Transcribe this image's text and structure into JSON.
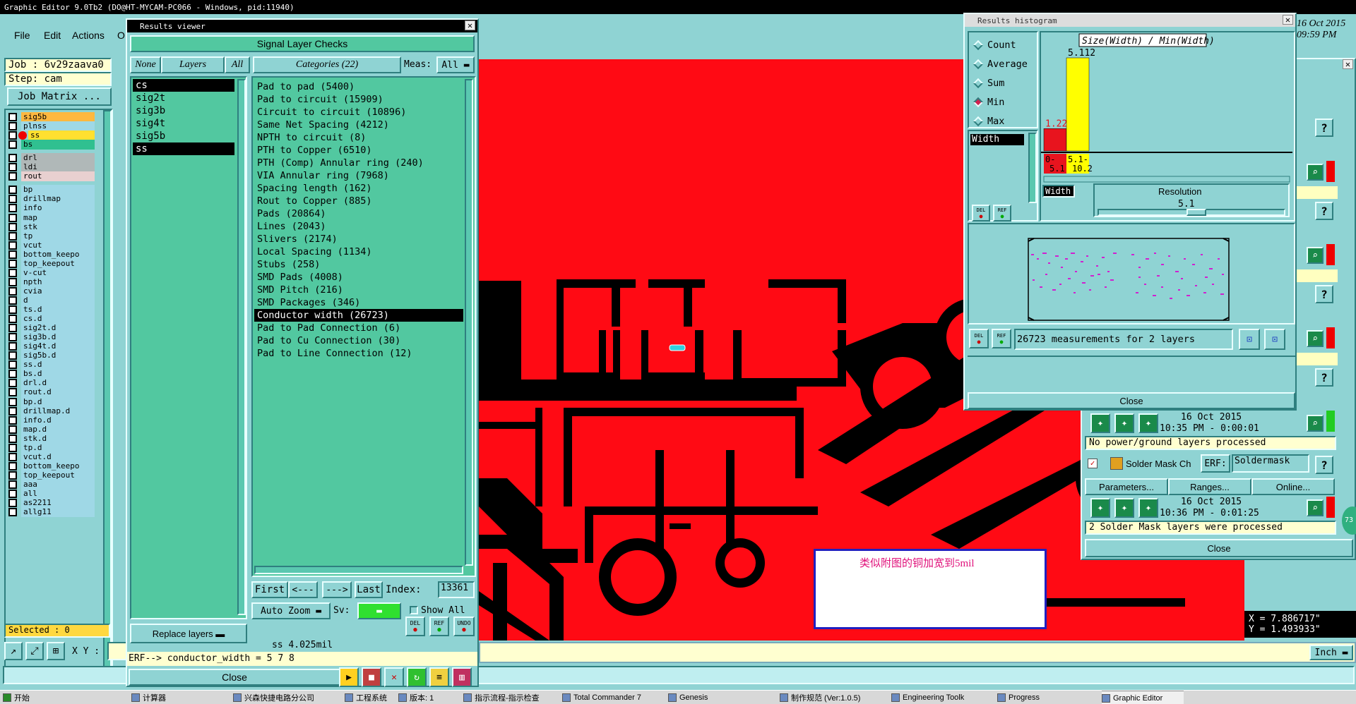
{
  "main_window": {
    "title": "Graphic Editor 9.0Tb2 (DO@HT-MYCAM-PC066 - Windows, pid:11940)",
    "menu": [
      "File",
      "Edit",
      "Actions",
      "O"
    ],
    "date_line1": "16 Oct 2015",
    "date_line2": "09:59 PM"
  },
  "job_panel": {
    "job_label": "Job : 6v29zaava0",
    "step_label": "Step: cam",
    "job_matrix_button": "Job Matrix ...",
    "selected_label": "Selected : 0",
    "xy_label": "X Y :",
    "layers": [
      {
        "name": "sig5b",
        "color": "#ffb840"
      },
      {
        "name": "plnss",
        "color": "#9fd8e6"
      },
      {
        "name": "ss",
        "color": "#ffe030",
        "marker": "red"
      },
      {
        "name": "bs",
        "color": "#30c090"
      },
      {
        "name": "drl",
        "color": "#b0b8b8"
      },
      {
        "name": "ldi",
        "color": "#b0b8b8"
      },
      {
        "name": "rout",
        "color": "#e8d0d0"
      },
      {
        "name": "bp",
        "color": "#9fd8e6"
      },
      {
        "name": "drillmap",
        "color": "#9fd8e6"
      },
      {
        "name": "info",
        "color": "#9fd8e6"
      },
      {
        "name": "map",
        "color": "#9fd8e6"
      },
      {
        "name": "stk",
        "color": "#9fd8e6"
      },
      {
        "name": "tp",
        "color": "#9fd8e6"
      },
      {
        "name": "vcut",
        "color": "#9fd8e6"
      },
      {
        "name": "bottom_keepo",
        "color": "#9fd8e6"
      },
      {
        "name": "top_keepout",
        "color": "#9fd8e6"
      },
      {
        "name": "v-cut",
        "color": "#9fd8e6"
      },
      {
        "name": "npth",
        "color": "#9fd8e6"
      },
      {
        "name": "cvia",
        "color": "#9fd8e6"
      },
      {
        "name": "d",
        "color": "#9fd8e6"
      },
      {
        "name": "ts.d",
        "color": "#9fd8e6"
      },
      {
        "name": "cs.d",
        "color": "#9fd8e6"
      },
      {
        "name": "sig2t.d",
        "color": "#9fd8e6"
      },
      {
        "name": "sig3b.d",
        "color": "#9fd8e6"
      },
      {
        "name": "sig4t.d",
        "color": "#9fd8e6"
      },
      {
        "name": "sig5b.d",
        "color": "#9fd8e6"
      },
      {
        "name": "ss.d",
        "color": "#9fd8e6"
      },
      {
        "name": "bs.d",
        "color": "#9fd8e6"
      },
      {
        "name": "drl.d",
        "color": "#9fd8e6"
      },
      {
        "name": "rout.d",
        "color": "#9fd8e6"
      },
      {
        "name": "bp.d",
        "color": "#9fd8e6"
      },
      {
        "name": "drillmap.d",
        "color": "#9fd8e6"
      },
      {
        "name": "info.d",
        "color": "#9fd8e6"
      },
      {
        "name": "map.d",
        "color": "#9fd8e6"
      },
      {
        "name": "stk.d",
        "color": "#9fd8e6"
      },
      {
        "name": "tp.d",
        "color": "#9fd8e6"
      },
      {
        "name": "vcut.d",
        "color": "#9fd8e6"
      },
      {
        "name": "bottom_keepo",
        "color": "#9fd8e6"
      },
      {
        "name": "top_keepout",
        "color": "#9fd8e6"
      },
      {
        "name": "aaa",
        "color": "#9fd8e6"
      },
      {
        "name": "all",
        "color": "#9fd8e6"
      },
      {
        "name": "as2211",
        "color": "#9fd8e6"
      },
      {
        "name": "allg11",
        "color": "#9fd8e6"
      }
    ]
  },
  "results_viewer": {
    "title": "Results viewer",
    "header": "Signal Layer Checks",
    "none_btn": "None",
    "layers_label": "Layers",
    "all_btn": "All",
    "categories_label": "Categories (22)",
    "meas_label": "Meas:",
    "meas_value": "All",
    "layers": [
      "cs",
      "sig2t",
      "sig3b",
      "sig4t",
      "sig5b",
      "ss"
    ],
    "categories": [
      "Pad to pad (5400)",
      "Pad to circuit (15909)",
      "Circuit to circuit (10896)",
      "Same Net Spacing (4212)",
      "NPTH to circuit (8)",
      "PTH to Copper (6510)",
      "PTH (Comp) Annular ring (240)",
      "VIA Annular ring (7968)",
      "Spacing length (162)",
      "Rout to Copper (885)",
      "Pads (20864)",
      "Lines (2043)",
      "Slivers (2174)",
      "Local Spacing (1134)",
      "Stubs (258)",
      "SMD Pads (4008)",
      "SMD Pitch (216)",
      "SMD Packages (346)",
      "Conductor width (26723)",
      "Pad to Pad Connection (6)",
      "Pad to Cu Connection (30)",
      "Pad to Line Connection (12)"
    ],
    "selected_category": "Conductor width (26723)",
    "first_btn": "First",
    "prev_btn": "<---",
    "next_btn": "--->",
    "last_btn": "Last",
    "index_label": "Index:",
    "index_value": "13361",
    "auto_zoom": "Auto Zoom",
    "sv_label": "Sv:",
    "show_all": "Show All",
    "replace_layers": "Replace layers",
    "del": "DEL",
    "ref": "REF",
    "undo": "UNDO",
    "status": "ss 4.025mil",
    "erf_line": "ERF--> conductor_width = 5 7 8",
    "close": "Close"
  },
  "histogram": {
    "title": "Results histogram",
    "options": [
      "Count",
      "Average",
      "Sum",
      "Min",
      "Max"
    ],
    "selected_option": "Min",
    "list_item": "Width",
    "chart_title": "Size(Width) / Min(Width)",
    "width_label": "Width",
    "resolution_label": "Resolution",
    "resolution_value": "5.1",
    "measurements": "26723 measurements for 2 layers",
    "close": "Close",
    "del": "DEL",
    "ref": "REF"
  },
  "chart_data": {
    "type": "bar",
    "title": "Size(Width) / Min(Width)",
    "categories": [
      "0-5.1",
      "5.1-10.2"
    ],
    "values": [
      1.228,
      5.112
    ],
    "colors": [
      "#e8141e",
      "#ffff00"
    ],
    "category_labels_line1": [
      "0-",
      "5.1-"
    ],
    "category_labels_line2": [
      "5.1",
      "10.2"
    ]
  },
  "analysis_panel": {
    "items": [
      {
        "date": "16 Oct 2015",
        "time": "10:35 PM - 0:00:01",
        "message": "No power/ground layers processed"
      },
      {
        "date": "16 Oct 2015",
        "time": "10:36 PM - 0:01:25",
        "message": "2 Solder Mask layers were processed"
      }
    ],
    "solder_label": "Solder Mask Ch",
    "erf_label": "ERF:",
    "erf_value": "Soldermask",
    "params_btn": "Parameters...",
    "ranges_btn": "Ranges...",
    "online_btn": "Online...",
    "close": "Close",
    "question": "?"
  },
  "canvas": {
    "note": "类似附图的铜加宽到5mil",
    "x_coord": "X = 7.886717\"",
    "y_coord": "Y = 1.493933\"",
    "unit": "Inch"
  },
  "taskbar": {
    "items": [
      "开始",
      "计算器",
      "兴森快捷电路分公司",
      "工程系统",
      "版本: 1",
      "指示流程-指示检查",
      "Total Commander 7",
      "Genesis",
      "制作规范 (Ver:1.0.5)",
      "Engineering Toolk",
      "Progress",
      "Graphic Editor"
    ]
  }
}
